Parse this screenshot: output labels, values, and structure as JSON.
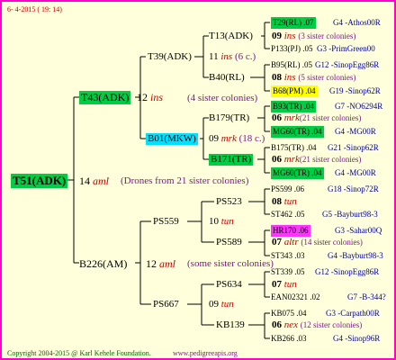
{
  "header": {
    "date": "6- 4-2015 ( 19: 14)"
  },
  "root": {
    "id": "T51(ADK)"
  },
  "gen2": {
    "mother": {
      "id": "T43(ADK)",
      "year": "12",
      "breed": "ins",
      "sisters": "(4 sister colonies)"
    },
    "drones": {
      "year": "14",
      "breed": "aml",
      "sisters": "(Drones from 21 sister colonies)"
    },
    "father": {
      "id": "B226(AM)",
      "year": "12",
      "breed": "aml",
      "sisters": "(some sister colonies)"
    }
  },
  "gen3": [
    {
      "id": "T39(ADK)",
      "year": "11",
      "breed": "ins",
      "sisters": "(6 c.)"
    },
    {
      "id": "B01(MKW)",
      "year": "09",
      "breed": "mrk",
      "sisters": "(18 c.)"
    },
    {
      "id": "PS559",
      "year": "10",
      "breed": "tun"
    },
    {
      "id": "PS667",
      "year": "09",
      "breed": "tun"
    }
  ],
  "gen4": [
    {
      "id": "T13(ADK)",
      "year": "09",
      "breed": "ins",
      "sisters": "(3 sister colonies)"
    },
    {
      "id": "B40(RL)",
      "year": "08",
      "breed": "ins",
      "sisters": "(5 sister colonies)"
    },
    {
      "id": "B179(TR)",
      "year": "06",
      "breed": "mrk",
      "sisters": "(21 sister colonies)"
    },
    {
      "id": "B171(TR)",
      "year": "06",
      "breed": "mrk",
      "sisters": "(21 sister colonies)"
    },
    {
      "id": "PS523",
      "year": "08",
      "breed": "tun"
    },
    {
      "id": "PS589",
      "year": "07",
      "breed": "altr",
      "sisters": "(14 sister colonies)"
    },
    {
      "id": "PS634",
      "year": "07",
      "breed": "tun"
    },
    {
      "id": "KB139",
      "year": "06",
      "breed": "nex",
      "sisters": "(12 sister colonies)"
    }
  ],
  "gen5": [
    {
      "id": "T29(RL) .07",
      "breeder": "G4 -Athos00R"
    },
    {
      "id": "P133(PJ) .05",
      "breeder": "G3 -PrimGreen00"
    },
    {
      "id": "B95(RL) .05",
      "breeder": "G12 -SinopEgg86R"
    },
    {
      "id": "B68(PM) .04",
      "breeder": "G19 -Sinop62R"
    },
    {
      "id": "B93(TR) .04",
      "breeder": "G7 -NO6294R"
    },
    {
      "id": "MG60(TR) .04",
      "breeder": "G4 -MG00R"
    },
    {
      "id": "B175(TR) .04",
      "breeder": "G21 -Sinop62R"
    },
    {
      "id": "MG60(TR) .04",
      "breeder": "G4 -MG00R"
    },
    {
      "id": "PS599 .06",
      "breeder": "G18 -Sinop72R"
    },
    {
      "id": "ST462 .05",
      "breeder": "G5 -Bayburt98-3"
    },
    {
      "id": "HR170 .06",
      "breeder": "G3 -Sahar00Q"
    },
    {
      "id": "ST343 .03",
      "breeder": "G4 -Bayburt98-3"
    },
    {
      "id": "ST339 .05",
      "breeder": "G12 -SinopEgg86R"
    },
    {
      "id": "EAN02321 .02",
      "breeder": "G7 -B-344?"
    },
    {
      "id": "KB075 .04",
      "breeder": "G3 -Carpath00R"
    },
    {
      "id": "KB266 .03",
      "breeder": "G4 -Sinop96R"
    }
  ],
  "footer": {
    "copyright": "Copyright 2004-2015 @ Karl Kehele Foundation.",
    "website": "www.pedigreeapis.org"
  }
}
